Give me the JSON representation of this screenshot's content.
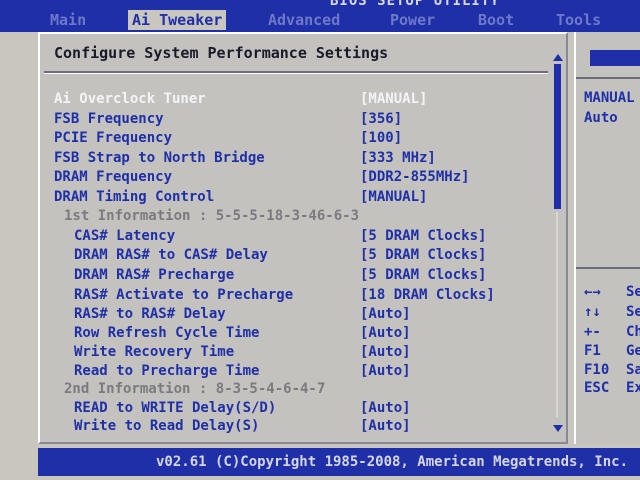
{
  "title": "BIOS SETUP UTILITY",
  "menu": [
    {
      "label": "Main"
    },
    {
      "label": "Ai Tweaker"
    },
    {
      "label": "Advanced"
    },
    {
      "label": "Power"
    },
    {
      "label": "Boot"
    },
    {
      "label": "Tools"
    }
  ],
  "panel": {
    "header": "Configure System Performance Settings",
    "rows": [
      {
        "label": "Ai Overclock Tuner",
        "value": "[MANUAL]"
      },
      {
        "label": "FSB Frequency",
        "value": "[356]"
      },
      {
        "label": "PCIE Frequency",
        "value": "[100]"
      },
      {
        "label": "FSB Strap to North Bridge",
        "value": "[333 MHz]"
      },
      {
        "label": "DRAM Frequency",
        "value": "[DDR2-855MHz]"
      },
      {
        "label": "DRAM Timing Control",
        "value": "[MANUAL]"
      },
      {
        "label": "1st Information : 5-5-5-18-3-46-6-3",
        "value": ""
      },
      {
        "label": "CAS# Latency",
        "value": "[5 DRAM Clocks]"
      },
      {
        "label": "DRAM RAS# to CAS# Delay",
        "value": "[5 DRAM Clocks]"
      },
      {
        "label": "DRAM RAS# Precharge",
        "value": "[5 DRAM Clocks]"
      },
      {
        "label": "RAS# Activate to Precharge",
        "value": "[18 DRAM Clocks]"
      },
      {
        "label": "RAS# to RAS# Delay",
        "value": "[Auto]"
      },
      {
        "label": "Row Refresh Cycle Time",
        "value": "[Auto]"
      },
      {
        "label": "Write Recovery Time",
        "value": "[Auto]"
      },
      {
        "label": "Read to Precharge Time",
        "value": "[Auto]"
      },
      {
        "label": "2nd Information : 8-3-5-4-6-4-7",
        "value": ""
      },
      {
        "label": "READ to WRITE Delay(S/D)",
        "value": "[Auto]"
      },
      {
        "label": "Write to Read Delay(S)",
        "value": "[Auto]"
      }
    ]
  },
  "side": {
    "options": [
      "MANUAL",
      "Auto"
    ],
    "legend": [
      {
        "key": "←→",
        "desc": "Se"
      },
      {
        "key": "↑↓",
        "desc": "Se"
      },
      {
        "key": "+-",
        "desc": "Ch"
      },
      {
        "key": "F1",
        "desc": "Ge"
      },
      {
        "key": "F10",
        "desc": "Sa"
      },
      {
        "key": "ESC",
        "desc": "Ex"
      }
    ]
  },
  "footer": "v02.61 (C)Copyright 1985-2008, American Megatrends, Inc.",
  "colors": {
    "accent": "#1f2fa8",
    "background": "#c4c2be",
    "highlight_text": "#f4f4f8"
  }
}
